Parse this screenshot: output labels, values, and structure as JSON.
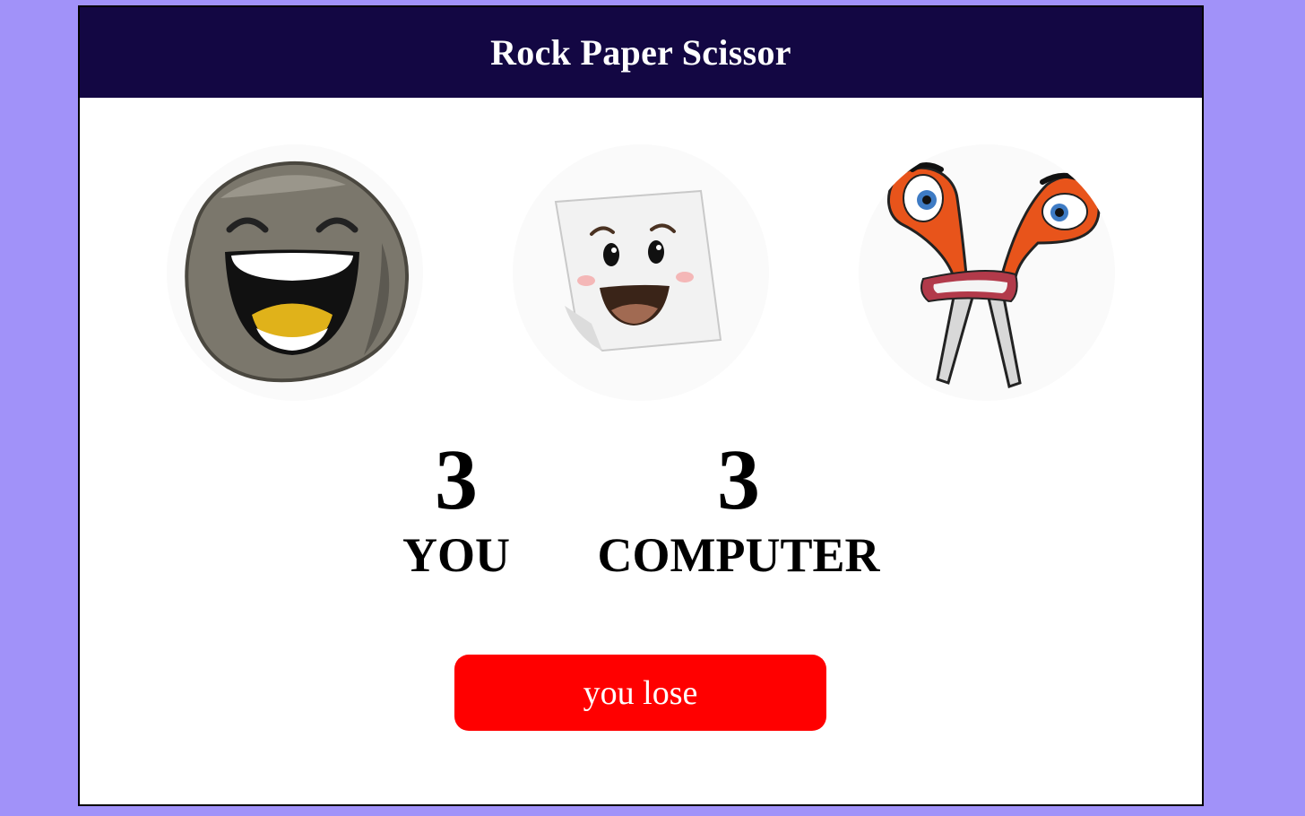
{
  "header": {
    "title": "Rock Paper Scissor"
  },
  "choices": [
    {
      "id": "rock",
      "icon": "rock-face-icon"
    },
    {
      "id": "paper",
      "icon": "paper-face-icon"
    },
    {
      "id": "scissor",
      "icon": "scissor-face-icon"
    }
  ],
  "scoreboard": {
    "you": {
      "score": "3",
      "label": "YOU"
    },
    "computer": {
      "score": "3",
      "label": "COMPUTER"
    }
  },
  "result": {
    "message": "you lose",
    "color": "#ff0000"
  },
  "colors": {
    "page_background": "#a192f9",
    "header_background": "#130743",
    "header_text": "#ffffff",
    "card_background": "#ffffff"
  }
}
